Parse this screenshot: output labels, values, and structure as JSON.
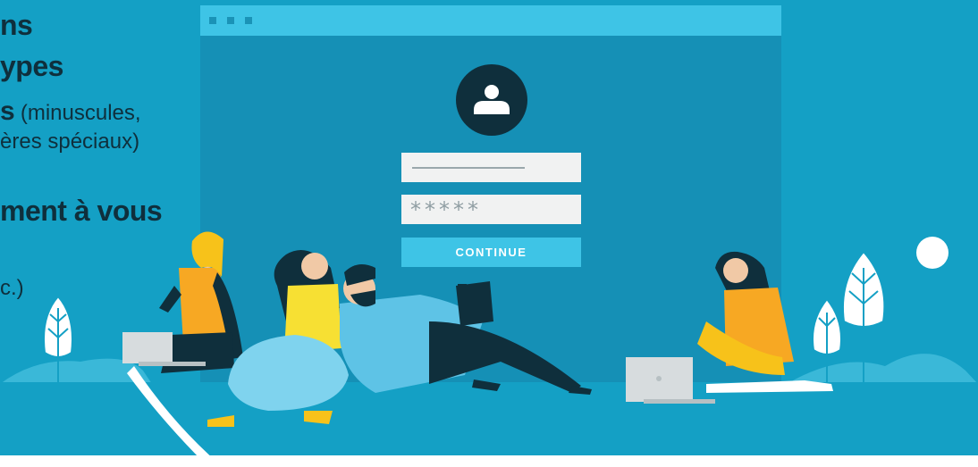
{
  "text": {
    "l1": "ns",
    "l2": "ypes",
    "l3_bold": "s",
    "l3_rest": " (minuscules,",
    "l4": "ères spéciaux)",
    "l5": "ment à vous",
    "l6": "c.)"
  },
  "form": {
    "password_mask": "*****",
    "continue_label": "CONTINUE"
  },
  "colors": {
    "background": "#14a0c5",
    "browser": "#1590b6",
    "accent": "#3ec4e6",
    "dark": "#0f2f3c",
    "yellow": "#f7c21a"
  },
  "icons": [
    "user-icon",
    "moon-icon",
    "leaf-plant-icon",
    "laptop-icon"
  ]
}
